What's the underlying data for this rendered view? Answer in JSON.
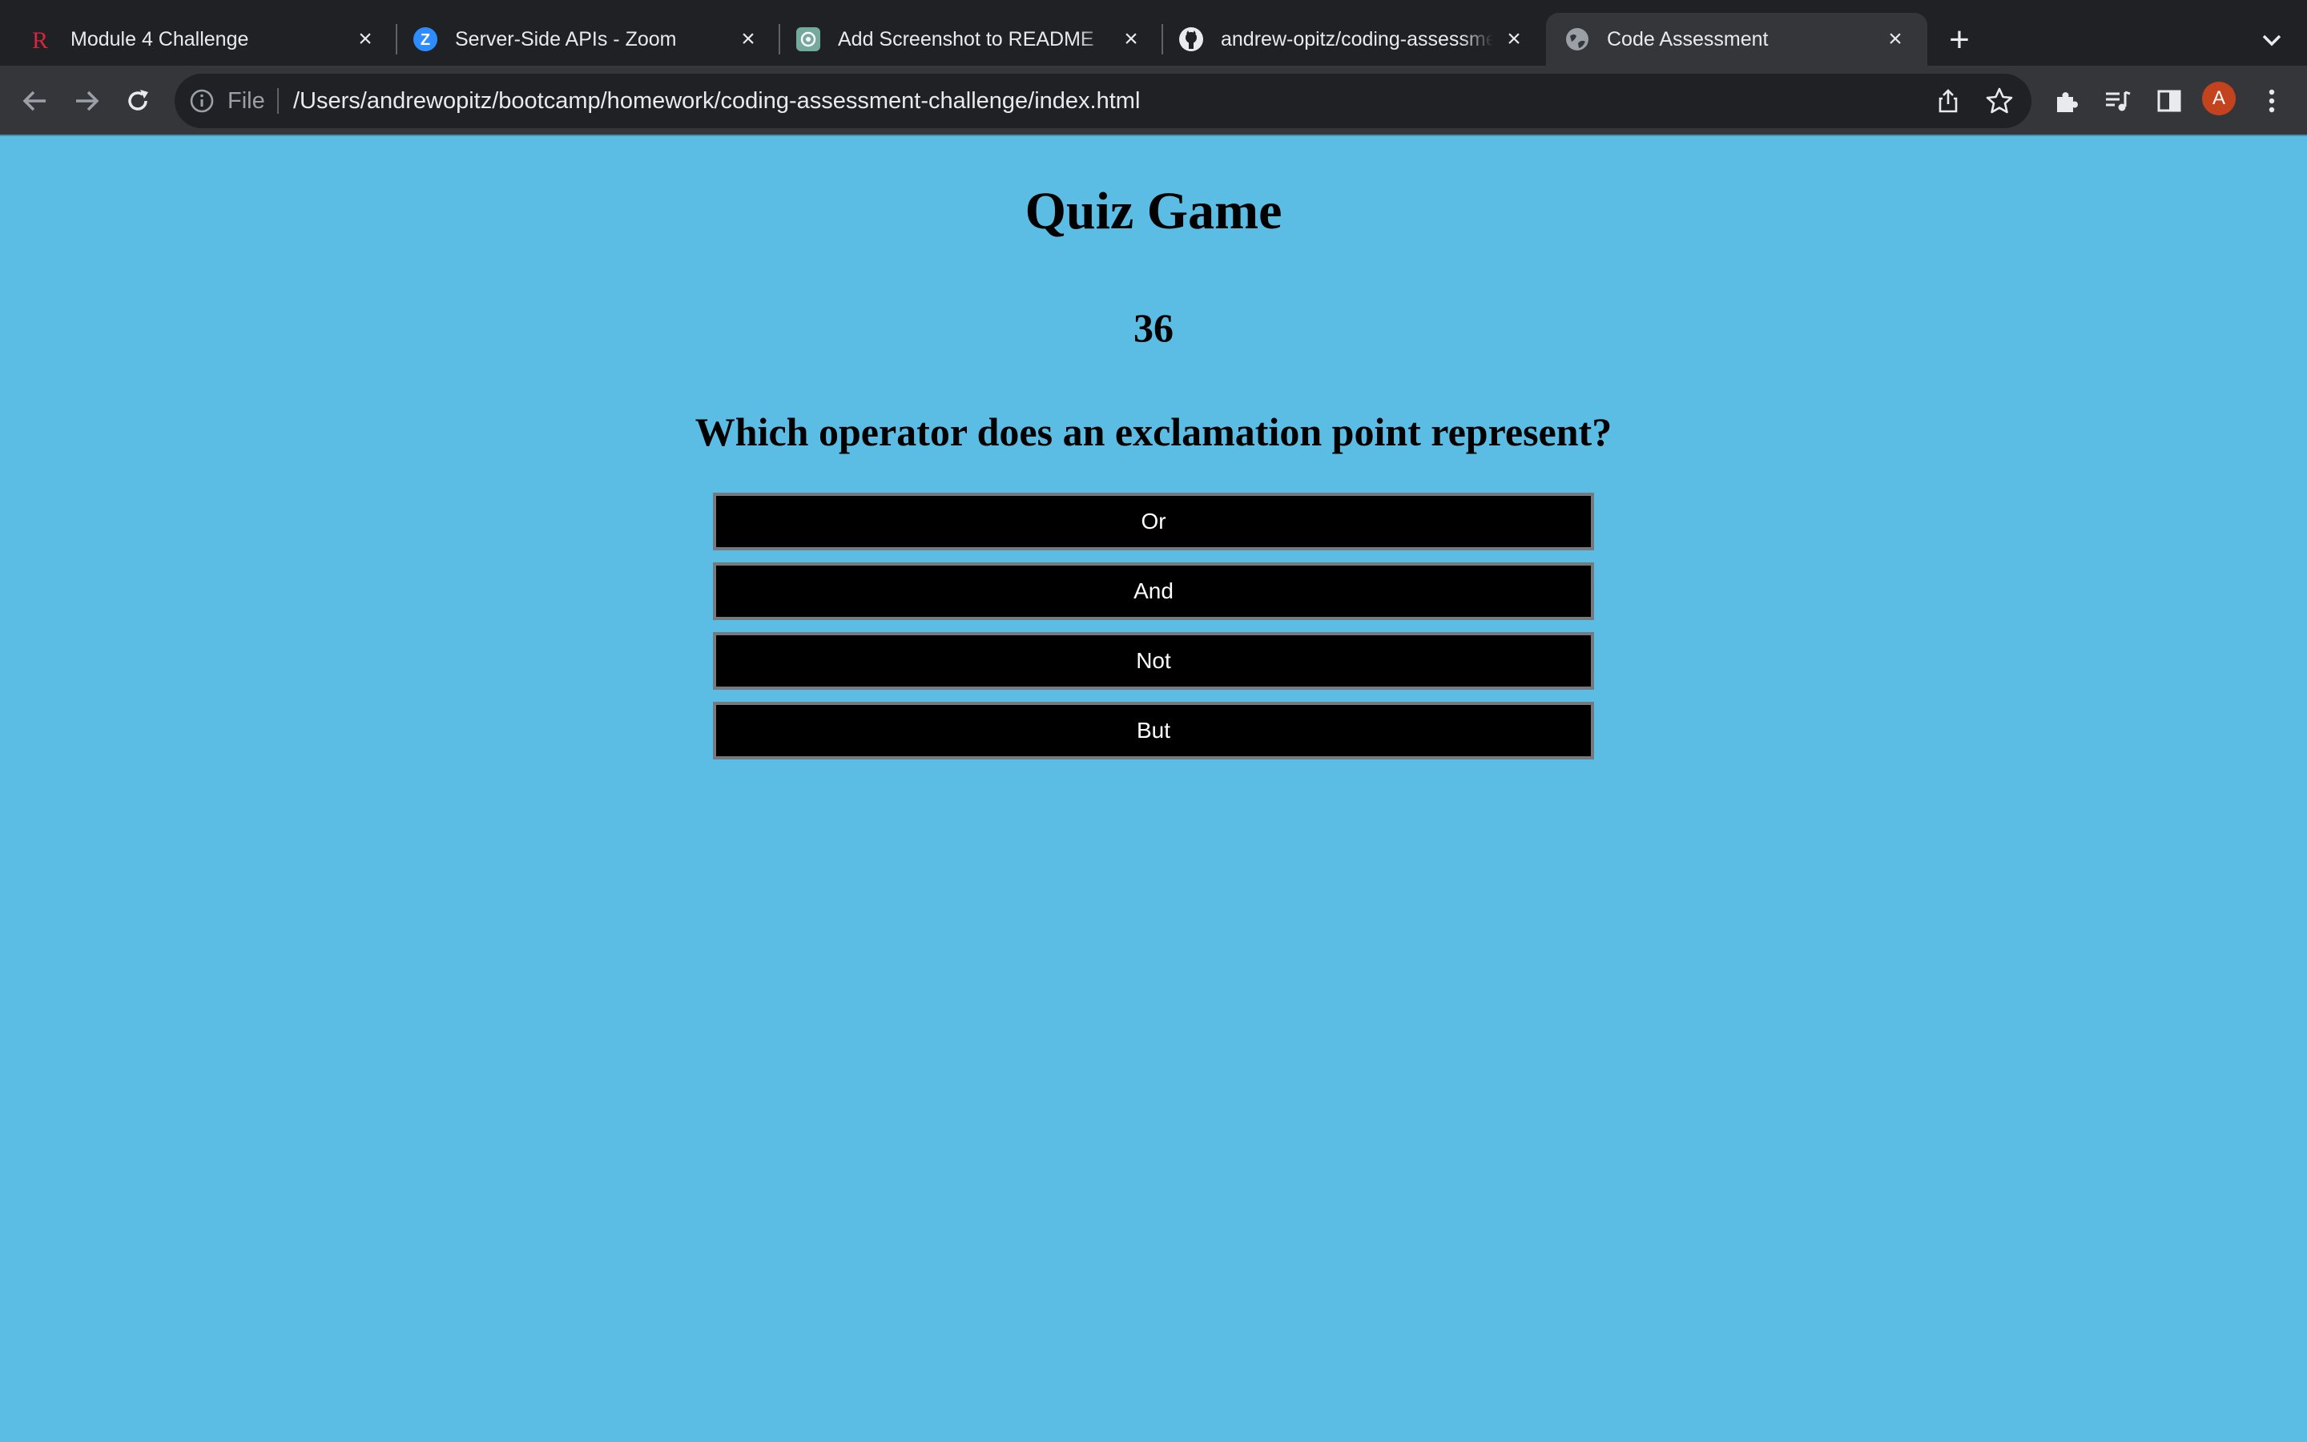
{
  "browser": {
    "tabs": [
      {
        "title": "Module 4 Challenge",
        "icon": "r-logo-icon"
      },
      {
        "title": "Server-Side APIs - Zoom",
        "icon": "zoom-icon"
      },
      {
        "title": "Add Screenshot to README",
        "icon": "chatgpt-icon"
      },
      {
        "title": "andrew-opitz/coding-assessment-challenge",
        "icon": "github-icon"
      },
      {
        "title": "Code Assessment",
        "icon": "globe-icon",
        "active": true
      }
    ],
    "address_bar": {
      "scheme_label": "File",
      "url": "/Users/andrewopitz/bootcamp/homework/coding-assessment-challenge/index.html"
    },
    "profile_initial": "A",
    "colors": {
      "tabstrip": "#202124",
      "toolbar": "#35363a",
      "avatar": "#c4431f"
    }
  },
  "page": {
    "title": "Quiz Game",
    "timer": "36",
    "question": "Which operator does an exclamation point represent?",
    "answers": [
      "Or",
      "And",
      "Not",
      "But"
    ],
    "colors": {
      "background": "#5bbde4",
      "button": "#000000",
      "button_text": "#ffffff"
    }
  }
}
